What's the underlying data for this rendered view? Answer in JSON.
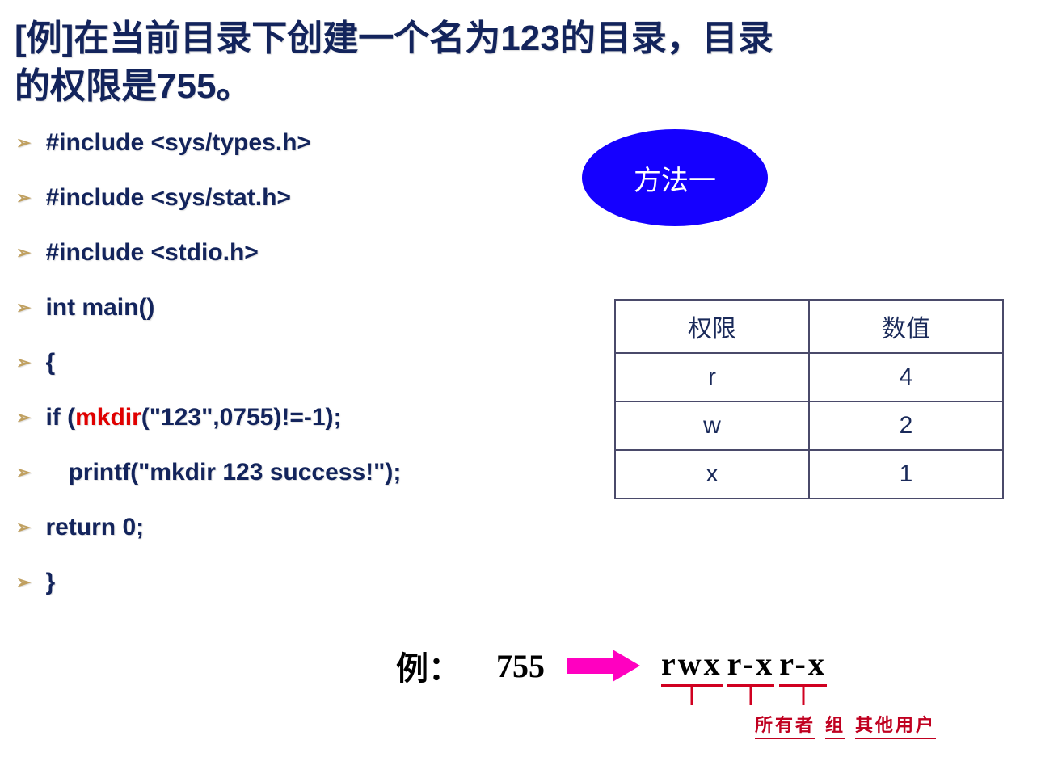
{
  "title": "[例]在当前目录下创建一个名为123的目录，目录的权限是755。",
  "oval": "方法一",
  "code": {
    "l1": "#include <sys/types.h>",
    "l2": "#include <sys/stat.h>",
    "l3": "#include <stdio.h>",
    "l4": "int main()",
    "l5": "{",
    "l6a": "if (",
    "l6b": "mkdir",
    "l6c": "(\"123\",0755)!=-1);",
    "l7": "printf(\"mkdir 123 success!\");",
    "l8": "return 0;",
    "l9": "}"
  },
  "table": {
    "h1": "权限",
    "h2": "数值",
    "rows": [
      {
        "p": "r",
        "v": "4"
      },
      {
        "p": "w",
        "v": "2"
      },
      {
        "p": "x",
        "v": "1"
      }
    ]
  },
  "example": {
    "label": "例：",
    "number": "755",
    "groups": {
      "g1": "rwx",
      "g2": "r-x",
      "g3": "r-x"
    },
    "names": {
      "n1": "所有者",
      "n2": "组",
      "n3": "其他用户"
    }
  }
}
